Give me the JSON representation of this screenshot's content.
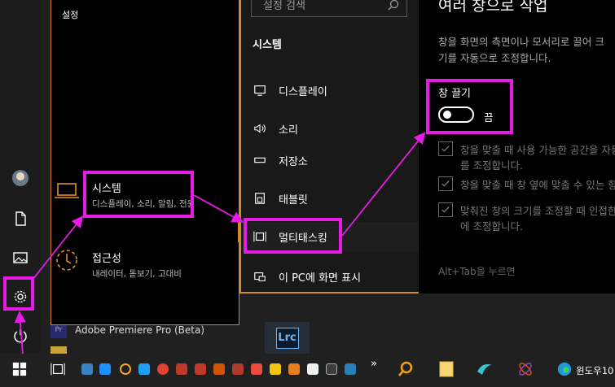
{
  "settings": {
    "window_title": "설정",
    "categories": [
      {
        "title": "시스템",
        "subtitle": "디스플레이, 소리, 알림, 전원"
      },
      {
        "title": "접근성",
        "subtitle": "내레이터, 돋보기, 고대비"
      }
    ]
  },
  "nav": {
    "search_placeholder": "설정 검색",
    "heading": "시스템",
    "items": [
      {
        "label": "디스플레이",
        "icon": "monitor-icon"
      },
      {
        "label": "소리",
        "icon": "speaker-icon"
      },
      {
        "label": "저장소",
        "icon": "storage-icon"
      },
      {
        "label": "태블릿",
        "icon": "tablet-icon"
      },
      {
        "label": "멀티태스킹",
        "icon": "multitasking-icon"
      },
      {
        "label": "이 PC에 화면 표시",
        "icon": "project-icon"
      }
    ]
  },
  "content": {
    "title": "여러 창으로 작업",
    "description": "창을 화면의 측면이나 모서리로 끌어 크기를 자동으로 조정합니다.",
    "snap_label": "창 끌기",
    "snap_state": "끔",
    "options": [
      {
        "line1": "창을 맞출 때 사용 가능한 공간을 자동으로 채우도록 크기",
        "line2": "를 조정합니다."
      },
      {
        "line1": "창을 맞출 때 창 옆에 맞출 수 있는 항목 표시"
      },
      {
        "line1": "맞춰진 창의 크기를 조정할 때 인접한 맞춰진 창의 크기를 동시",
        "line2": "에 조정합니다."
      }
    ],
    "footer_fade": "Alt+Tab을 누르면"
  },
  "background": {
    "app_label": "Adobe Premiere Pro (Beta)",
    "lrc_label": "Lrc"
  },
  "taskbar": {
    "tray_label": "윈도우10",
    "overflow": "»"
  },
  "colors": {
    "annotation": "#e61ce6",
    "accent": "#d48a2a"
  }
}
